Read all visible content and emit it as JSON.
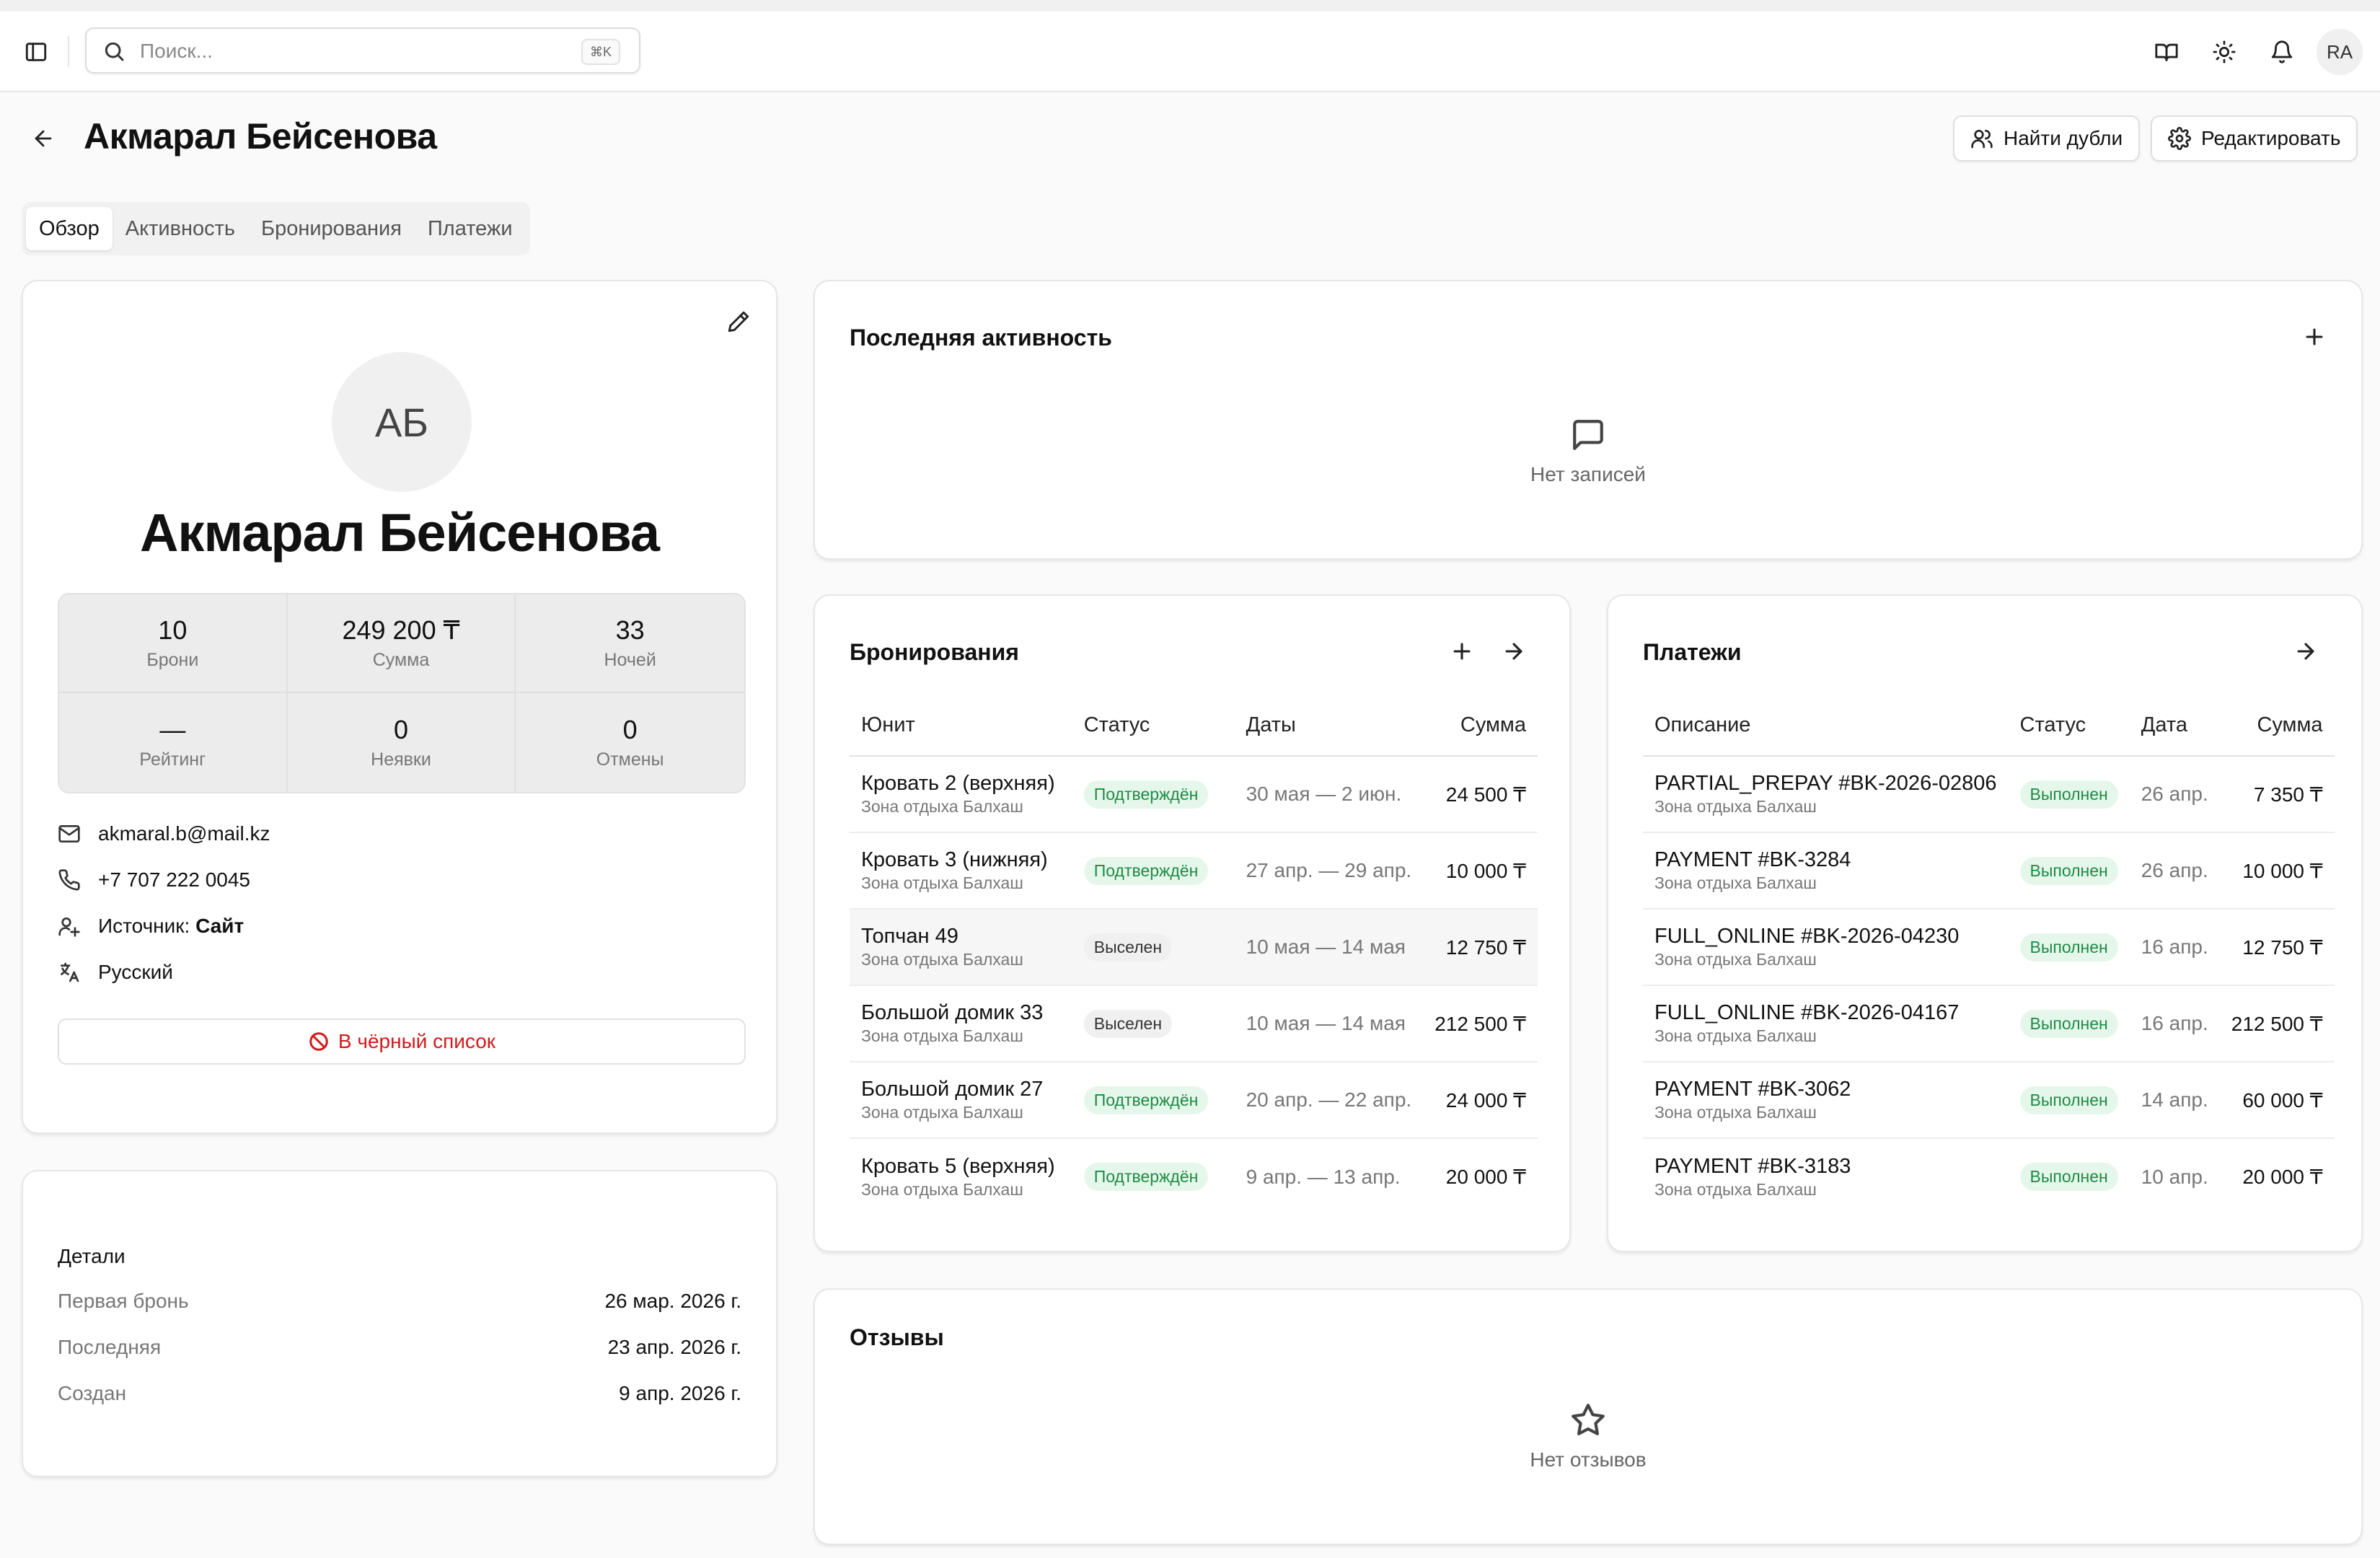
{
  "topbar": {
    "search_placeholder": "Поиск...",
    "search_shortcut": "⌘K",
    "user_initials": "RA"
  },
  "header": {
    "title": "Акмарал Бейсенова",
    "find_duplicates_label": "Найти дубли",
    "edit_label": "Редактировать"
  },
  "tabs": [
    {
      "label": "Обзор",
      "active": true
    },
    {
      "label": "Активность",
      "active": false
    },
    {
      "label": "Бронирования",
      "active": false
    },
    {
      "label": "Платежи",
      "active": false
    }
  ],
  "profile": {
    "initials": "АБ",
    "name": "Акмарал Бейсенова",
    "stats": [
      {
        "value": "10",
        "label": "Брони"
      },
      {
        "value": "249 200 ₸",
        "label": "Сумма"
      },
      {
        "value": "33",
        "label": "Ночей"
      },
      {
        "value": "—",
        "label": "Рейтинг"
      },
      {
        "value": "0",
        "label": "Неявки"
      },
      {
        "value": "0",
        "label": "Отмены"
      }
    ],
    "email": "akmaral.b@mail.kz",
    "phone": "+7 707 222 0045",
    "source_label": "Источник:",
    "source_value": "Сайт",
    "language": "Русский",
    "blacklist_label": "В чёрный список"
  },
  "details": {
    "title": "Детали",
    "rows": [
      {
        "label": "Первая бронь",
        "value": "26 мар. 2026 г."
      },
      {
        "label": "Последняя",
        "value": "23 апр. 2026 г."
      },
      {
        "label": "Создан",
        "value": "9 апр. 2026 г."
      }
    ]
  },
  "activity": {
    "title": "Последняя активность",
    "empty_text": "Нет записей"
  },
  "bookings": {
    "title": "Бронирования",
    "columns": [
      "Юнит",
      "Статус",
      "Даты",
      "Сумма"
    ],
    "rows": [
      {
        "unit": "Кровать 2 (верхняя)",
        "place": "Зона отдыха Балхаш",
        "status": "Подтверждён",
        "status_kind": "green",
        "dates": "30 мая — 2 июн.",
        "amount": "24 500 ₸"
      },
      {
        "unit": "Кровать 3 (нижняя)",
        "place": "Зона отдыха Балхаш",
        "status": "Подтверждён",
        "status_kind": "green",
        "dates": "27 апр. — 29 апр.",
        "amount": "10 000 ₸"
      },
      {
        "unit": "Топчан 49",
        "place": "Зона отдыха Балхаш",
        "status": "Выселен",
        "status_kind": "gray",
        "dates": "10 мая — 14 мая",
        "amount": "12 750 ₸"
      },
      {
        "unit": "Большой домик 33",
        "place": "Зона отдыха Балхаш",
        "status": "Выселен",
        "status_kind": "gray",
        "dates": "10 мая — 14 мая",
        "amount": "212 500 ₸"
      },
      {
        "unit": "Большой домик 27",
        "place": "Зона отдыха Балхаш",
        "status": "Подтверждён",
        "status_kind": "green",
        "dates": "20 апр. — 22 апр.",
        "amount": "24 000 ₸"
      },
      {
        "unit": "Кровать 5 (верхняя)",
        "place": "Зона отдыха Балхаш",
        "status": "Подтверждён",
        "status_kind": "green",
        "dates": "9 апр. — 13 апр.",
        "amount": "20 000 ₸"
      }
    ]
  },
  "payments": {
    "title": "Платежи",
    "columns": [
      "Описание",
      "Статус",
      "Дата",
      "Сумма"
    ],
    "rows": [
      {
        "desc": "PARTIAL_PREPAY #BK-2026-02806",
        "place": "Зона отдыха Балхаш",
        "status": "Выполнен",
        "date": "26 апр.",
        "amount": "7 350 ₸"
      },
      {
        "desc": "PAYMENT #BK-3284",
        "place": "Зона отдыха Балхаш",
        "status": "Выполнен",
        "date": "26 апр.",
        "amount": "10 000 ₸"
      },
      {
        "desc": "FULL_ONLINE #BK-2026-04230",
        "place": "Зона отдыха Балхаш",
        "status": "Выполнен",
        "date": "16 апр.",
        "amount": "12 750 ₸"
      },
      {
        "desc": "FULL_ONLINE #BK-2026-04167",
        "place": "Зона отдыха Балхаш",
        "status": "Выполнен",
        "date": "16 апр.",
        "amount": "212 500 ₸"
      },
      {
        "desc": "PAYMENT #BK-3062",
        "place": "Зона отдыха Балхаш",
        "status": "Выполнен",
        "date": "14 апр.",
        "amount": "60 000 ₸"
      },
      {
        "desc": "PAYMENT #BK-3183",
        "place": "Зона отдыха Балхаш",
        "status": "Выполнен",
        "date": "10 апр.",
        "amount": "20 000 ₸"
      }
    ]
  },
  "reviews": {
    "title": "Отзывы",
    "empty_text": "Нет отзывов"
  },
  "colors": {
    "danger": "#d11a1a",
    "success_text": "#1f8a46",
    "success_bg": "#e5f7ea"
  },
  "icons": [
    "sidebar-toggle-icon",
    "search-icon",
    "book-icon",
    "sun-icon",
    "bell-icon",
    "arrow-left-icon",
    "users-icon",
    "gear-icon",
    "pencil-icon",
    "mail-icon",
    "phone-icon",
    "user-plus-icon",
    "translate-icon",
    "ban-icon",
    "message-icon",
    "plus-icon",
    "arrow-right-icon",
    "star-icon"
  ]
}
